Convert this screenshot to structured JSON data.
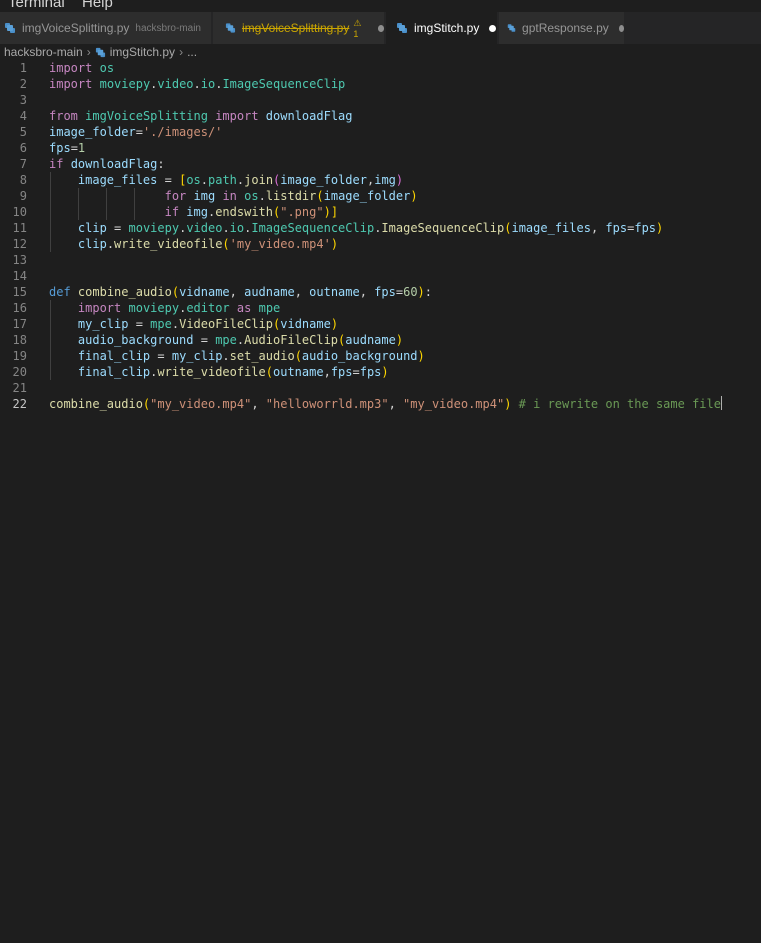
{
  "menu": {
    "items": [
      "Terminal",
      "Help"
    ]
  },
  "tabs": [
    {
      "label": "imgVoiceSplitting.py",
      "sub": "hacksbro-main"
    },
    {
      "label": "imgVoiceSplitting.py",
      "count": "1"
    },
    {
      "label": "imgStitch.py"
    },
    {
      "label": "gptResponse.py"
    }
  ],
  "breadcrumb": {
    "folder": "hacksbro-main",
    "file": "imgStitch.py",
    "more": "..."
  },
  "editor": {
    "line_numbers": [
      "1",
      "2",
      "3",
      "4",
      "5",
      "6",
      "7",
      "8",
      "9",
      "10",
      "11",
      "12",
      "13",
      "14",
      "15",
      "16",
      "17",
      "18",
      "19",
      "20",
      "21",
      "22"
    ],
    "current_line": "22",
    "lines": [
      "import os",
      "import moviepy.video.io.ImageSequenceClip",
      "",
      "from imgVoiceSplitting import downloadFlag",
      "image_folder='./images/'",
      "fps=1",
      "if downloadFlag:",
      "    image_files = [os.path.join(image_folder,img)",
      "                for img in os.listdir(image_folder)",
      "                if img.endswith(\".png\")]",
      "    clip = moviepy.video.io.ImageSequenceClip.ImageSequenceClip(image_files, fps=fps)",
      "    clip.write_videofile('my_video.mp4')",
      "",
      "",
      "def combine_audio(vidname, audname, outname, fps=60):",
      "    import moviepy.editor as mpe",
      "    my_clip = mpe.VideoFileClip(vidname)",
      "    audio_background = mpe.AudioFileClip(audname)",
      "    final_clip = my_clip.set_audio(audio_background)",
      "    final_clip.write_videofile(outname,fps=fps)",
      "",
      "combine_audio(\"my_video.mp4\", \"helloworrld.mp3\", \"my_video.mp4\") # i rewrite on the same file"
    ]
  },
  "colors": {
    "background": "#1e1e1e",
    "keyword": "#c586c0",
    "module": "#4ec9b0",
    "function": "#dcdcaa",
    "variable": "#9cdcfe",
    "string": "#ce9178",
    "number": "#b5cea8",
    "comment": "#6a9955"
  }
}
